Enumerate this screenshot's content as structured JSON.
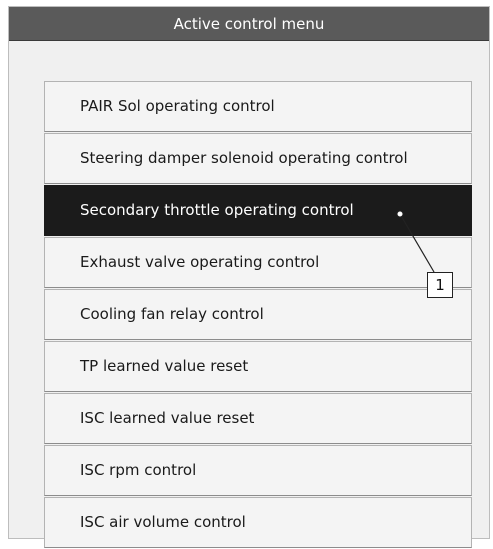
{
  "window": {
    "title": "Active control menu"
  },
  "menu": {
    "items": [
      {
        "label": "PAIR Sol operating control"
      },
      {
        "label": "Steering damper solenoid operating control"
      },
      {
        "label": "Secondary throttle operating control",
        "selected": true
      },
      {
        "label": "Exhaust valve operating control"
      },
      {
        "label": "Cooling fan relay control"
      },
      {
        "label": "TP learned value reset"
      },
      {
        "label": "ISC learned value reset"
      },
      {
        "label": "ISC rpm control"
      },
      {
        "label": "ISC air volume control"
      }
    ]
  },
  "callout": {
    "label": "1"
  },
  "colors": {
    "titlebar": "#5a5a5a",
    "selected_item": "#1b1b1b",
    "item_bg": "#f4f4f4"
  }
}
